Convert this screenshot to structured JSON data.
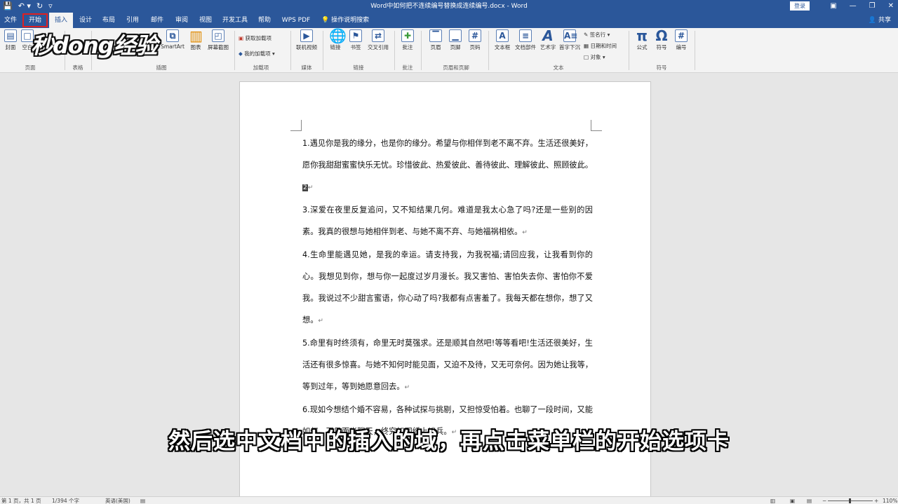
{
  "titlebar": {
    "doc_title": "Word中如何把不连续编号替换成连续编号.docx - Word",
    "login": "登录",
    "qat": {
      "save_icon": "save-icon",
      "undo_icon": "undo-icon",
      "redo_icon": "redo-icon",
      "customize_icon": "customize-icon"
    },
    "controls": {
      "minimize": "—",
      "restore": "❐",
      "close": "✕"
    }
  },
  "menubar": {
    "tabs": [
      "文件",
      "开始",
      "插入",
      "设计",
      "布局",
      "引用",
      "邮件",
      "审阅",
      "视图",
      "开发工具",
      "帮助",
      "WPS PDF"
    ],
    "help_search": "操作说明搜索",
    "share": "共享",
    "highlight_color": "#e02020"
  },
  "ribbon": {
    "items": {
      "cover": "封面",
      "blank": "空白",
      "smartart": "SmartArt",
      "chart": "图表",
      "screenshot": "屏幕截图",
      "get_addins": "获取加载项",
      "my_addins": "我的加载项",
      "online_video": "联机视频",
      "link": "链接",
      "bookmark": "书签",
      "cross_ref": "交叉引用",
      "comment": "批注",
      "header": "页眉",
      "footer": "页脚",
      "page_number": "页码",
      "textbox": "文本框",
      "quick_parts": "文档部件",
      "wordart": "艺术字",
      "dropcap": "首字下沉",
      "signature_line": "签名行",
      "date_time": "日期和时间",
      "object": "对象",
      "equation": "公式",
      "symbol": "符号",
      "number": "编号"
    },
    "groups": {
      "pages": "页面",
      "tables": "表格",
      "illustrations": "插图",
      "addins": "加载项",
      "media": "媒体",
      "links": "链接",
      "comments": "批注",
      "header_footer": "页眉和页脚",
      "text": "文本",
      "symbols": "符号"
    }
  },
  "watermark": "秒dong经验",
  "document": {
    "paragraphs": [
      "1.遇见你是我的缘分，也是你的缘分。希望与你相伴到老不离不弃。生活还很美好，愿你我甜甜蜜蜜快乐无忧。珍惜彼此、热爱彼此、善待彼此、理解彼此、照顾彼此。",
      "3.深爱在夜里反复追问，又不知结果几何。难道是我太心急了吗?还是一些别的因素。我真的很想与她相伴到老、与她不离不弃、与她福祸相依。",
      "4.生命里能遇见她，是我的幸运。请支持我，为我祝福;请回应我，让我看到你的心。我想见到你，想与你一起度过岁月漫长。我又害怕、害怕失去你、害怕你不爱我。我说过不少甜言蜜语，你心动了吗?我都有点害羞了。我每天都在想你，想了又想。",
      "5.命里有时终须有，命里无时莫强求。还是顺其自然吧!等等看吧!生活还很美好，生活还有很多惊喜。与她不知何时能见面，又迫不及待，又无可奈何。因为她让我等，等到过年，等到她愿意回去。",
      "6.现如今想结个婚不容易，各种试探与挑剔，又担惊受怕着。也聊了一段时间，又能如何。不见面光聊天，终究如同纸上谈兵。"
    ],
    "field_mark": "2"
  },
  "subtitle": "然后选中文档中的插入的域，再点击菜单栏的开始选项卡",
  "statusbar": {
    "page": "第 1 页，共 1 页",
    "words": "1/394 个字",
    "language": "英语(美国)",
    "zoom": "110%"
  }
}
